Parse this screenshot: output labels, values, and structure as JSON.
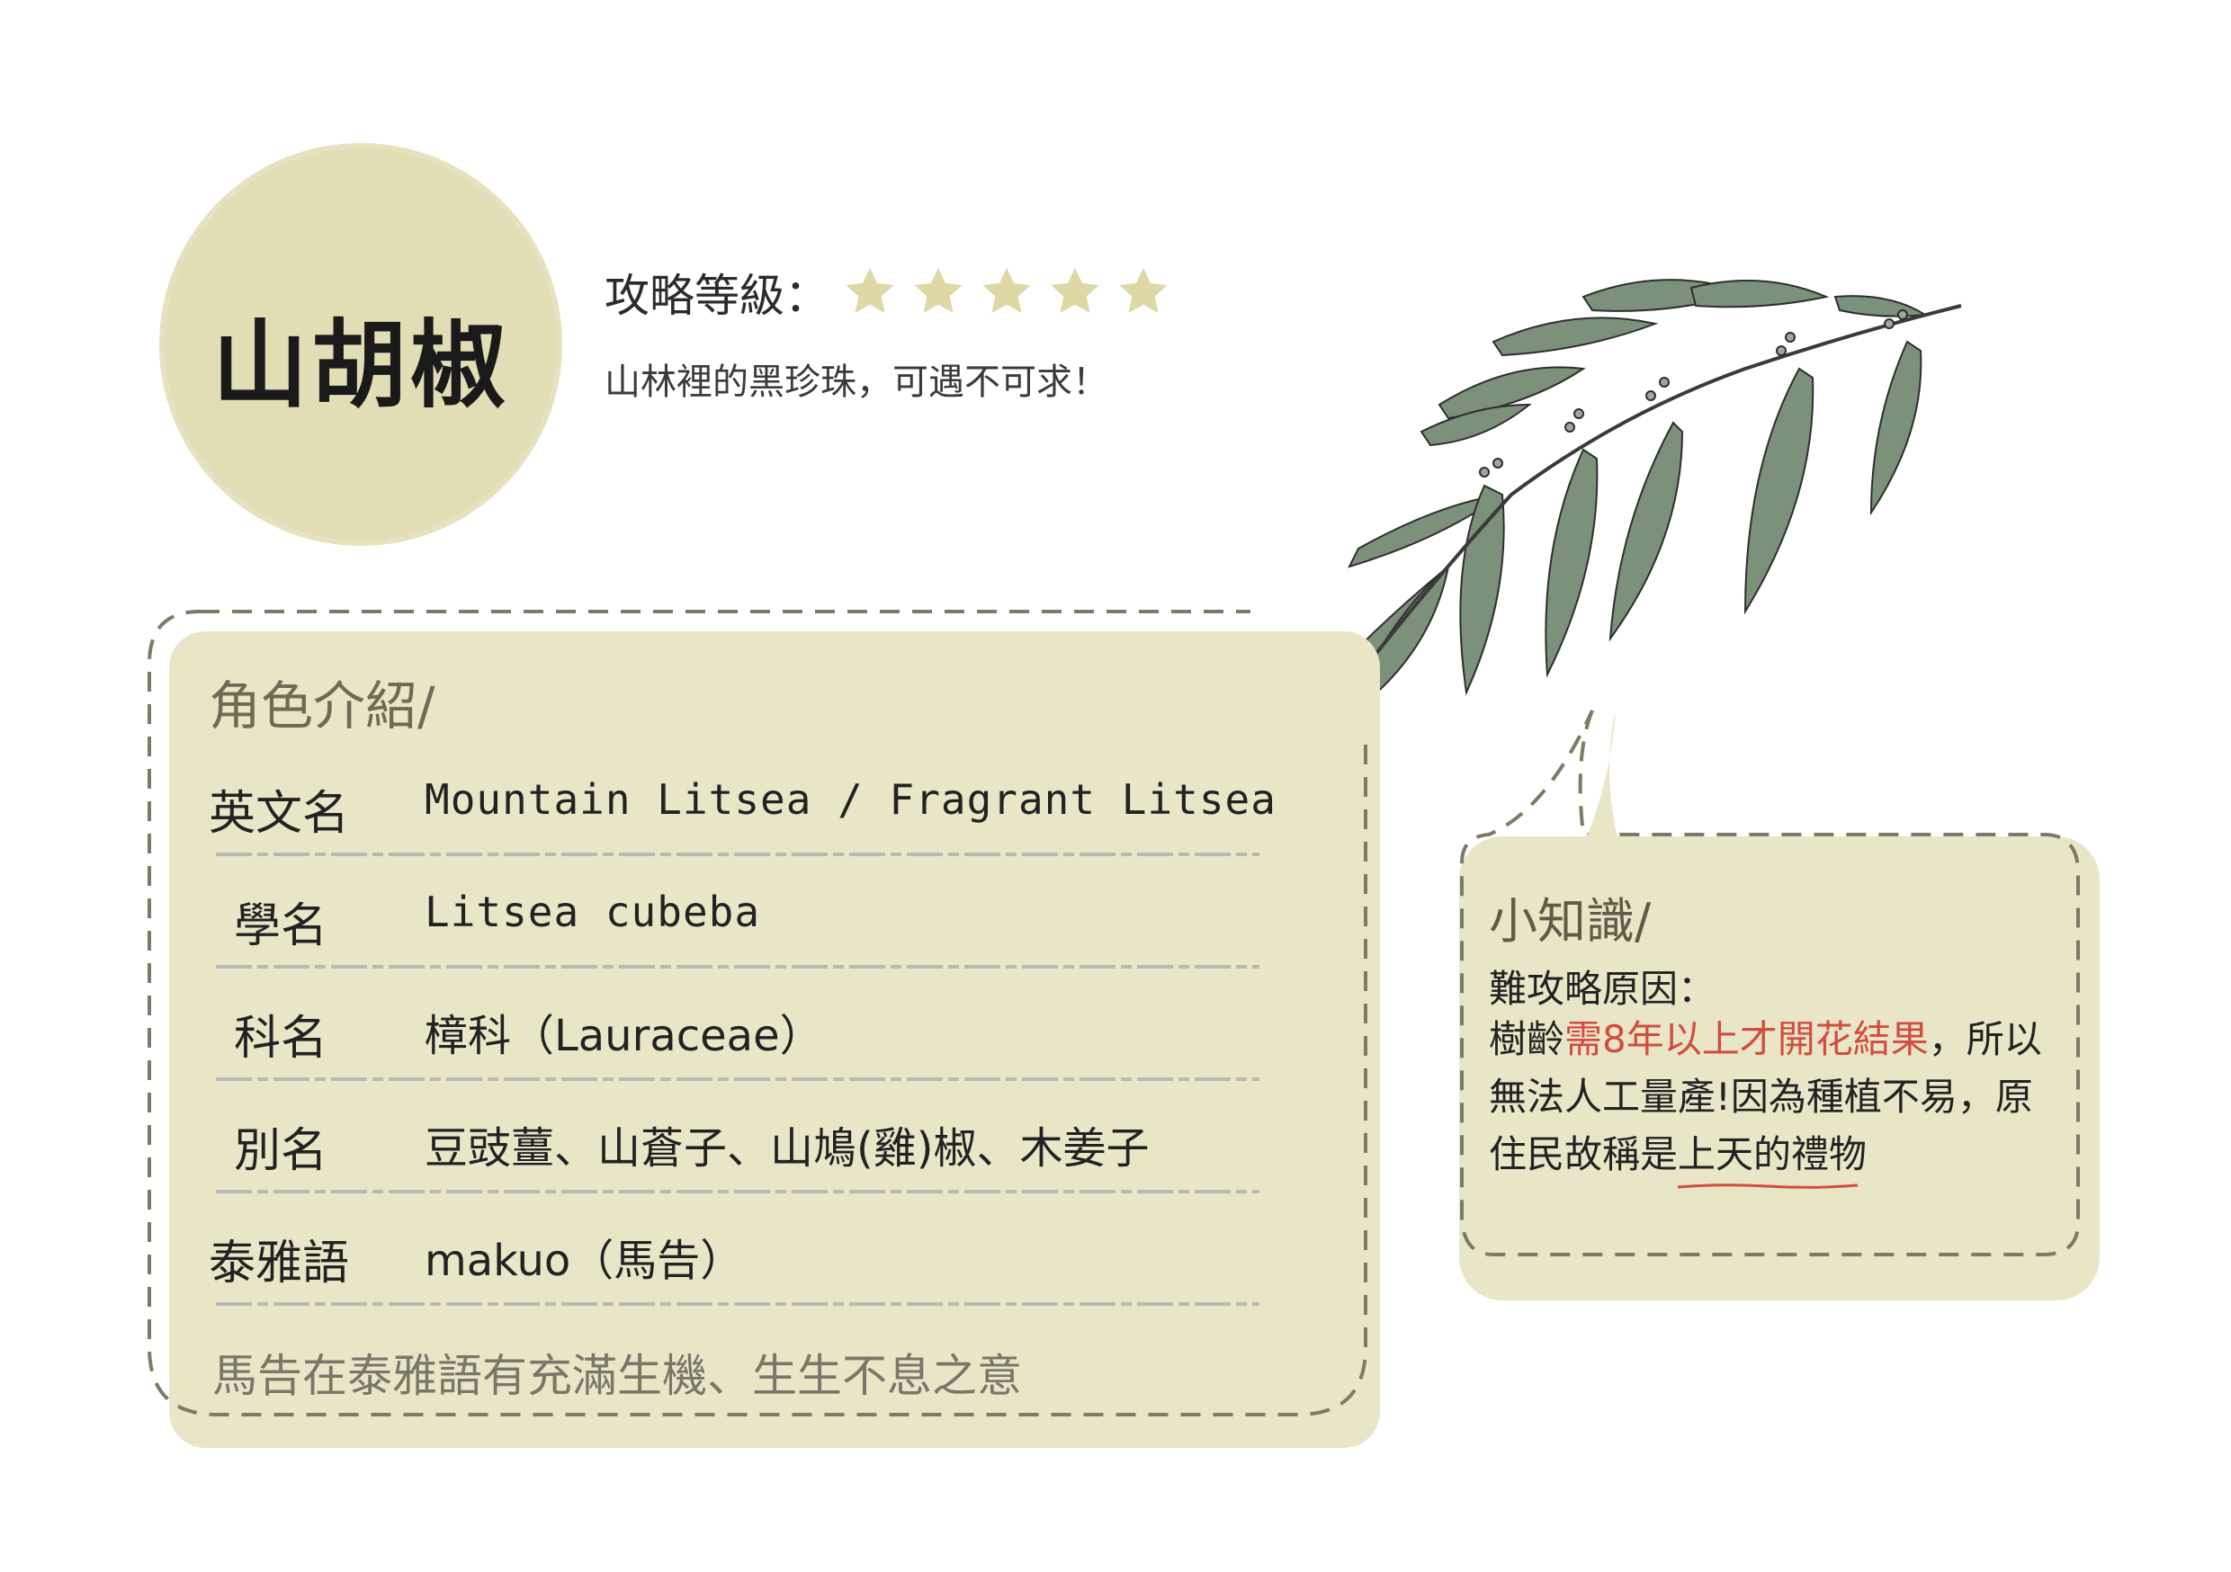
{
  "title": "山胡椒",
  "level": {
    "label": "攻略等級：",
    "stars_total": 5,
    "stars_filled": 5,
    "star_color": "#ddd8a6"
  },
  "tagline": "山林裡的黑珍珠，可遇不可求！",
  "intro": {
    "heading": "角色介紹/",
    "rows": [
      {
        "label": "英文名",
        "value": "Mountain Litsea / Fragrant Litsea"
      },
      {
        "label": "學名",
        "value": "Litsea cubeba"
      },
      {
        "label": "科名",
        "value": "樟科（Lauraceae）"
      },
      {
        "label": "別名",
        "value": "豆豉薑、山蒼子、山鳩(雞)椒、木姜子"
      },
      {
        "label": "泰雅語",
        "value": "makuo（馬告）"
      }
    ],
    "note": "馬告在泰雅語有充滿生機、生生不息之意"
  },
  "knowledge": {
    "heading": "小知識/",
    "subheading": "難攻略原因：",
    "text_1": "樹齡",
    "text_highlight": "需8年以上才開花結果",
    "text_2": "，所以無法人工量產!因為種植不易，原住民故稱是",
    "text_underlined": "上天的禮物"
  },
  "colors": {
    "card_bg": "#e9e6c8",
    "badge_bg": "#e1ddb5",
    "dash": "#7d7a66",
    "highlight": "#d34c3e",
    "leaf": "#7b917a"
  },
  "icons": {
    "star": "star-icon",
    "branch": "litsea-branch-illustration"
  }
}
